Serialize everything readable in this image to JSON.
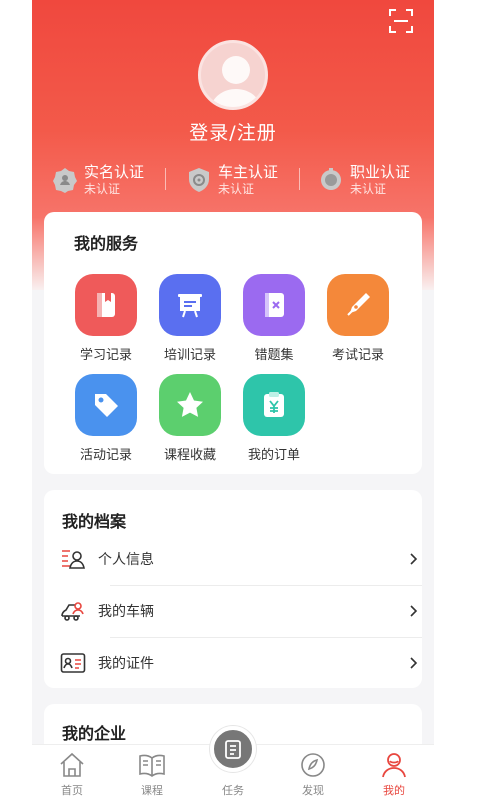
{
  "header": {
    "login_label": "登录/注册"
  },
  "certifications": [
    {
      "title": "实名认证",
      "status": "未认证",
      "icon": "id-badge-icon"
    },
    {
      "title": "车主认证",
      "status": "未认证",
      "icon": "car-shield-icon"
    },
    {
      "title": "职业认证",
      "status": "未认证",
      "icon": "medal-icon"
    }
  ],
  "services": {
    "title": "我的服务",
    "items": [
      {
        "label": "学习记录",
        "icon": "book-icon",
        "color": "#ef5a5a"
      },
      {
        "label": "培训记录",
        "icon": "presentation-board-icon",
        "color": "#5a6ff0"
      },
      {
        "label": "错题集",
        "icon": "error-notebook-icon",
        "color": "#9b6af0"
      },
      {
        "label": "考试记录",
        "icon": "pen-nib-icon",
        "color": "#f4883a"
      },
      {
        "label": "活动记录",
        "icon": "tag-icon",
        "color": "#4a92ee"
      },
      {
        "label": "课程收藏",
        "icon": "star-icon",
        "color": "#5ccf6e"
      },
      {
        "label": "我的订单",
        "icon": "order-clipboard-icon",
        "color": "#2ec5aa"
      }
    ]
  },
  "profile": {
    "title": "我的档案",
    "rows": [
      {
        "label": "个人信息",
        "icon": "personal-info-icon"
      },
      {
        "label": "我的车辆",
        "icon": "vehicle-icon"
      },
      {
        "label": "我的证件",
        "icon": "id-card-icon"
      }
    ]
  },
  "enterprise": {
    "title": "我的企业"
  },
  "tabbar": {
    "items": [
      {
        "label": "首页",
        "icon": "home-icon"
      },
      {
        "label": "课程",
        "icon": "open-book-icon"
      },
      {
        "label": "任务",
        "icon": "task-icon"
      },
      {
        "label": "发现",
        "icon": "compass-icon"
      },
      {
        "label": "我的",
        "icon": "user-icon"
      }
    ],
    "active": "我的"
  },
  "colors": {
    "brand": "#f0483e",
    "active_tab": "#e8473f"
  }
}
